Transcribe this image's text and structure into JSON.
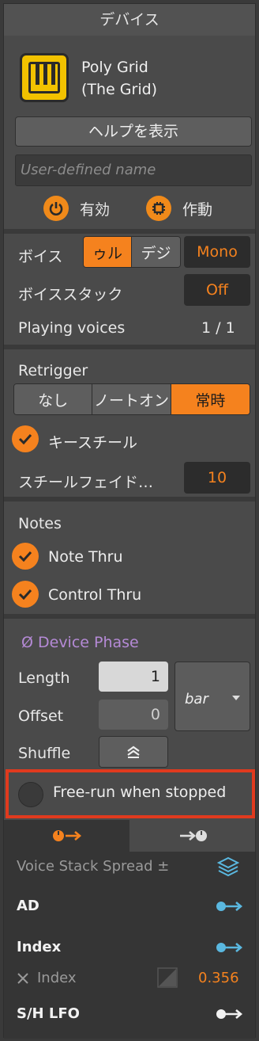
{
  "header": {
    "title": "デバイス"
  },
  "device": {
    "name_line1": "Poly Grid",
    "name_line2": "(The Grid)",
    "icon": "piano-keys-icon",
    "icon_color": "#f2c200"
  },
  "help_button": {
    "label": "ヘルプを表示"
  },
  "name_field": {
    "placeholder": "User-defined name"
  },
  "toggles": {
    "enabled_label": "有効",
    "active_label": "作動"
  },
  "voices": {
    "label": "ボイス",
    "mode_options": [
      "トゥルー",
      "デジ"
    ],
    "mode_visible": [
      "ゥル",
      "デジ"
    ],
    "selected_mode": "トゥルー",
    "mono_value": "Mono",
    "stack_label": "ボイススタック",
    "stack_value": "Off",
    "playing_label": "Playing voices",
    "playing_value": "1 / 1"
  },
  "retrigger": {
    "label": "Retrigger",
    "options": [
      "なし",
      "ノートオン",
      "常時"
    ],
    "selected": "常時",
    "key_steal_label": "キースチール",
    "key_steal_checked": true,
    "steal_fade_label": "スチールフェイド…",
    "steal_fade_value": "10"
  },
  "notes": {
    "label": "Notes",
    "note_thru_label": "Note Thru",
    "note_thru_checked": true,
    "control_thru_label": "Control Thru",
    "control_thru_checked": true
  },
  "phase": {
    "title": "Ø Device Phase",
    "length_label": "Length",
    "length_value": "1",
    "offset_label": "Offset",
    "offset_value": "0",
    "unit_value": "bar",
    "shuffle_label": "Shuffle",
    "free_run_label": "Free-run when stopped",
    "free_run_checked": false
  },
  "modulators": {
    "spread_label": "Voice Stack Spread ±",
    "ad_label": "AD",
    "index_label": "Index",
    "index_sub_label": "Index",
    "index_value": "0.356",
    "sh_lfo_label": "S/H LFO"
  },
  "colors": {
    "accent": "#f5821e",
    "phase": "#b58ad6",
    "highlight": "#e03a1e",
    "mod_arrow": "#5ab8e0"
  }
}
